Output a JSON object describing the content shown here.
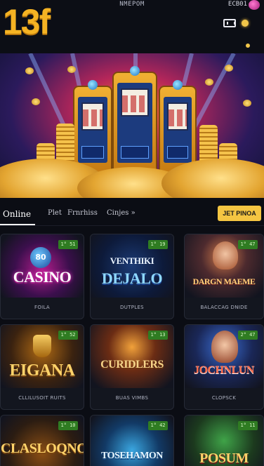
{
  "header": {
    "logo_text": "13f",
    "center_text": "NMEPOM",
    "right_text": "ECB01",
    "ticket_icon": "ticket-icon",
    "coin_icon": "coin-icon"
  },
  "hero": {
    "description_icon": "slot-machines-banner"
  },
  "tabs": {
    "items": [
      {
        "label": "Online"
      },
      {
        "label": "Plet"
      },
      {
        "label": "Frnrhiss"
      },
      {
        "label": "Cinjes »"
      }
    ],
    "cta_label": "JET PINOA"
  },
  "games": [
    {
      "badge": "1° 51",
      "title": "CASINO",
      "emblem": "80",
      "caption": "FOILA"
    },
    {
      "badge": "1° 19",
      "title": "DEJALO",
      "subtitle": "VENTHIKI",
      "caption": "DUTPLES"
    },
    {
      "badge": "1° 47",
      "title": "DARGN MAEME",
      "caption": "BALACCAG DNIDE"
    },
    {
      "badge": "1° 52",
      "title": "EIGANA",
      "caption": "CLLILUSOIT RUITS"
    },
    {
      "badge": "1° 13",
      "title": "CURIDLERS",
      "caption": "BUAS VIMBS"
    },
    {
      "badge": "2° 47",
      "title": "JOCHNLUN",
      "caption": "CLOPSCK"
    },
    {
      "badge": "1° 10",
      "title": "CLASLOQNO",
      "caption": ""
    },
    {
      "badge": "1° 42",
      "title": "TOSEHAMON",
      "caption": ""
    },
    {
      "badge": "1° 11",
      "title": "POSUM",
      "caption": ""
    }
  ],
  "colors": {
    "accent": "#f4c542",
    "badge": "#2f7c22",
    "background": "#0b0d14"
  }
}
